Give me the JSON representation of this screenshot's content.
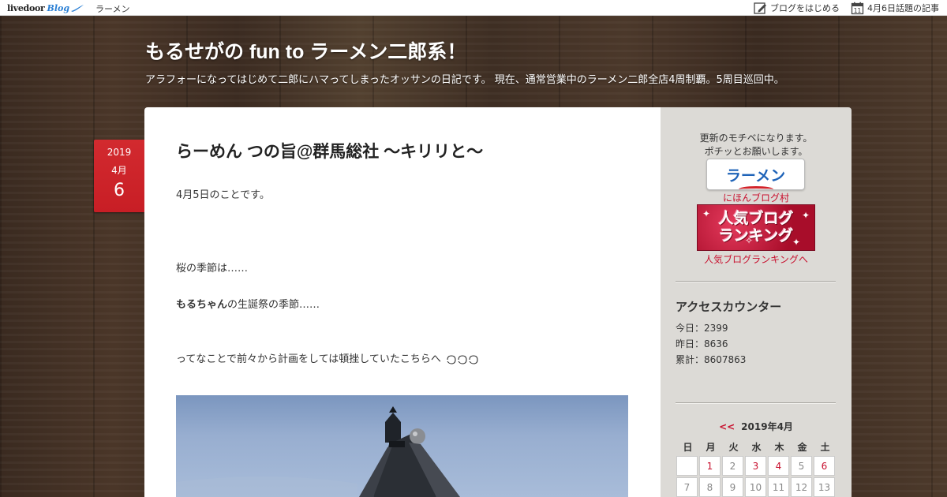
{
  "topbar": {
    "logo_text": "livedoor",
    "logo_blog": "Blog",
    "category": "ラーメン",
    "start_blog": "ブログをはじめる",
    "topic_articles": "4月6日話題の記事",
    "calendar_icon_day": "11"
  },
  "header": {
    "title": "もるせがの fun to ラーメン二郎系！",
    "description": "アラフォーになってはじめて二郎にハマってしまったオッサンの日記です。 現在、通常営業中のラーメン二郎全店4周制覇。5周目巡回中。"
  },
  "post": {
    "date": {
      "year": "2019",
      "month": "4月",
      "day": "6"
    },
    "title": "らーめん つの旨@群馬総社 〜キリリと〜",
    "paragraphs": {
      "p1": "4月5日のことです。",
      "p2": "桜の季節は……",
      "p3_bold": "もるちゃん",
      "p3_rest": "の生誕祭の季節……",
      "p4": "ってなことで前々から計画をしては頓挫していたこちらへ"
    }
  },
  "sidebar": {
    "note_line1": "更新のモチベになります。",
    "note_line2": "ポチッとお願いします。",
    "ramen_banner": "ラーメン",
    "nihon_link": "にほんブログ村",
    "rank_line1": "人気ブログ",
    "rank_line2": "ランキング",
    "rank_link": "人気ブログランキングへ",
    "counter_title": "アクセスカウンター",
    "counter_today": "今日：2399",
    "counter_yesterday": "昨日：8636",
    "counter_total": "累計：8607863"
  },
  "calendar": {
    "prev": "<<",
    "month": "2019年4月",
    "dow": [
      "日",
      "月",
      "火",
      "水",
      "木",
      "金",
      "土"
    ],
    "row1": [
      "",
      "1",
      "2",
      "3",
      "4",
      "5",
      "6"
    ],
    "row2": [
      "7",
      "8",
      "9",
      "10",
      "11",
      "12",
      "13"
    ],
    "linked_days": [
      "1",
      "3",
      "4",
      "6"
    ]
  },
  "colors": {
    "accent_red": "#c8102e",
    "date_badge": "#d22a2f",
    "banner_blue": "#1e63b8",
    "sidebar_bg": "#dcdad6"
  }
}
